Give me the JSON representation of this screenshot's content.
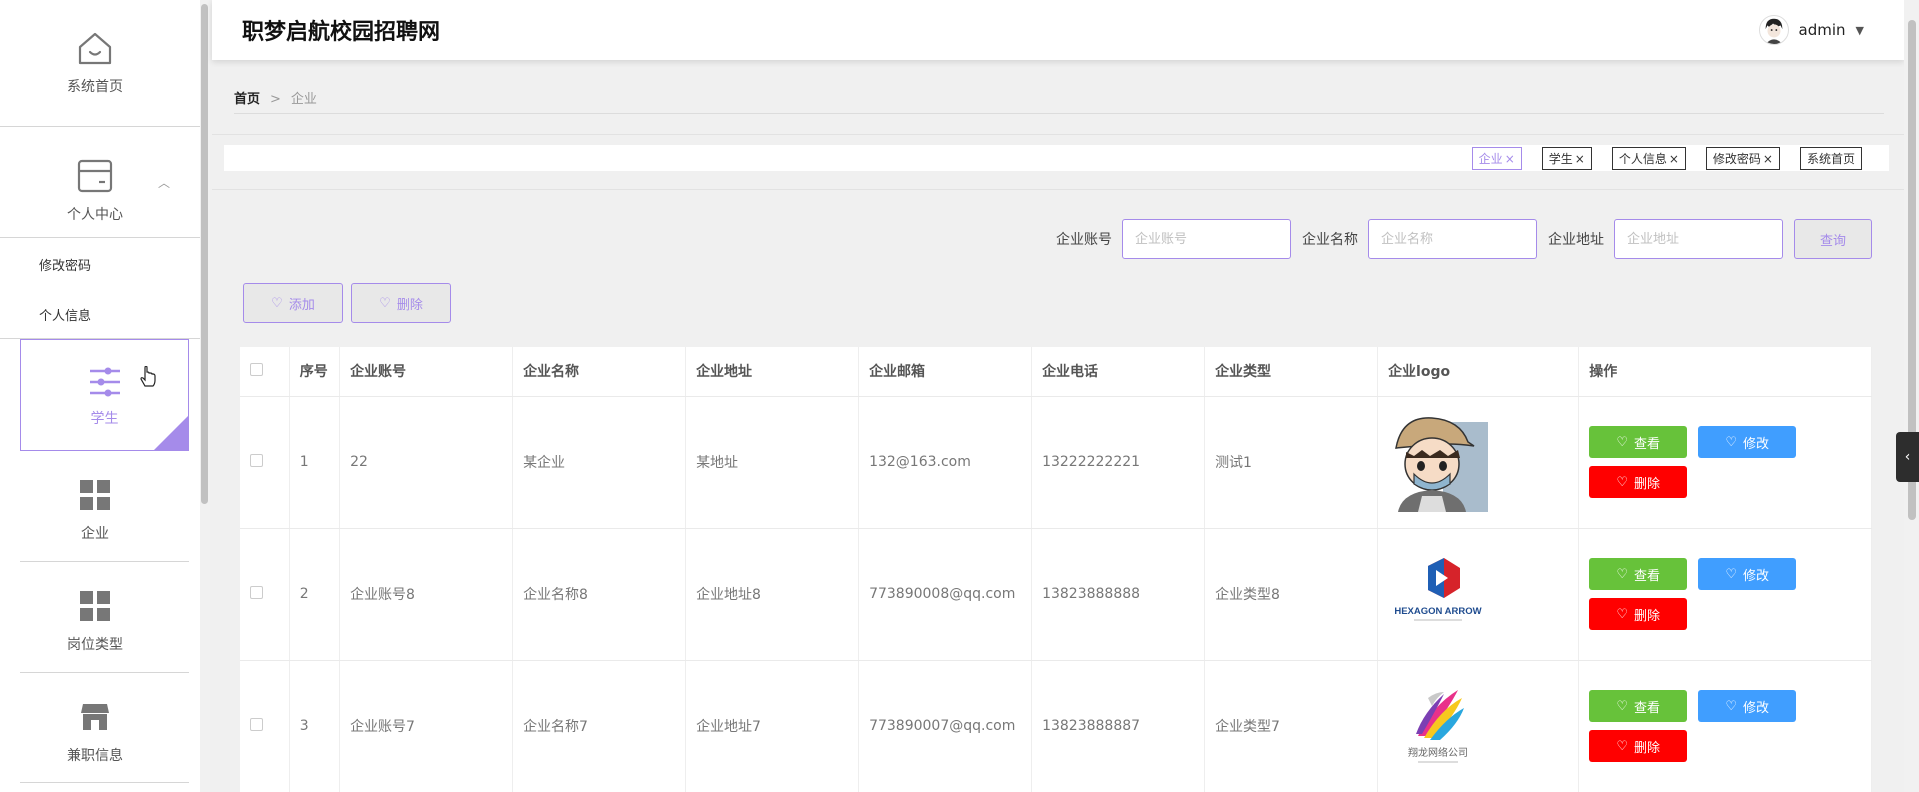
{
  "app": {
    "title": "职梦启航校园招聘网"
  },
  "user": {
    "name": "admin"
  },
  "sidebar": {
    "home": "系统首页",
    "personal": "个人中心",
    "sub_items": [
      "修改密码",
      "个人信息"
    ],
    "student": "学生",
    "company": "企业",
    "job_type": "岗位类型",
    "part_time": "兼职信息"
  },
  "breadcrumb": {
    "home": "首页",
    "separator": ">",
    "current": "企业"
  },
  "tags": [
    {
      "label": "企业",
      "active": true
    },
    {
      "label": "学生",
      "active": false
    },
    {
      "label": "个人信息",
      "active": false
    },
    {
      "label": "修改密码",
      "active": false
    },
    {
      "label": "系统首页",
      "active": false
    }
  ],
  "tag_close": "×",
  "search": {
    "account_label": "企业账号",
    "account_placeholder": "企业账号",
    "name_label": "企业名称",
    "name_placeholder": "企业名称",
    "address_label": "企业地址",
    "address_placeholder": "企业地址",
    "query_button": "查询"
  },
  "actions": {
    "add": "添加",
    "delete": "删除"
  },
  "table": {
    "headers": [
      "序号",
      "企业账号",
      "企业名称",
      "企业地址",
      "企业邮箱",
      "企业电话",
      "企业类型",
      "企业logo",
      "操作"
    ],
    "rows": [
      {
        "index": "1",
        "account": "22",
        "name": "某企业",
        "address": "某地址",
        "email": "132@163.com",
        "phone": "13222222221",
        "type": "测试1",
        "logo": "avatar-cartoon-icon"
      },
      {
        "index": "2",
        "account": "企业账号8",
        "name": "企业名称8",
        "address": "企业地址8",
        "email": "773890008@qq.com",
        "phone": "13823888888",
        "type": "企业类型8",
        "logo": "hexagon-arrow-logo",
        "logo_text": "HEXAGON ARROW"
      },
      {
        "index": "3",
        "account": "企业账号7",
        "name": "企业名称7",
        "address": "企业地址7",
        "email": "773890007@qq.com",
        "phone": "13823888887",
        "type": "企业类型7",
        "logo": "feather-logo",
        "logo_text": "翔龙网络公司"
      }
    ],
    "op_view": "查看",
    "op_edit": "修改",
    "op_delete": "删除"
  },
  "colors": {
    "accent": "#a58bea",
    "view": "#67c23a",
    "edit": "#409eff",
    "delete": "#ff0000"
  }
}
